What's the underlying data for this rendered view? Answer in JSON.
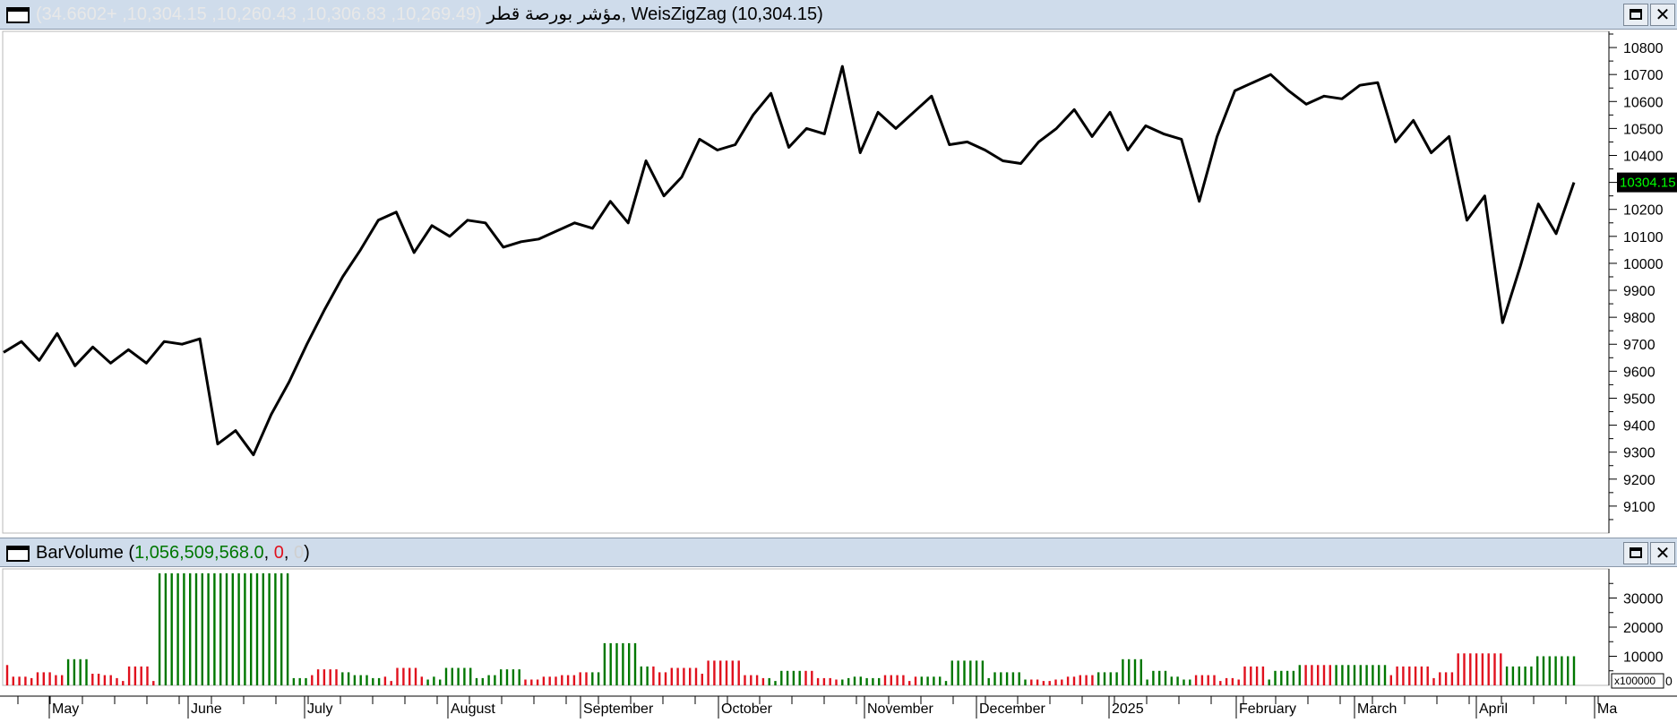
{
  "price_panel": {
    "icon": "window-icon",
    "symbol_name": "مؤشر بورصة قطر",
    "ohlc_text": "(10,269.49, 10,306.83, 10,260.43, 10,304.15, +34.6602)",
    "indicator_text": ", WeisZigZag (10,304.15)",
    "last_price_label": "10304.15",
    "last_price_color": "#000000",
    "last_price_text_color": "#00ff00"
  },
  "volume_panel": {
    "icon": "window-icon",
    "name": "BarVolume",
    "open_paren": " (",
    "value1": "1,056,509,568.0",
    "sep1": ", ",
    "value2": "0",
    "sep2": ", ",
    "value3": "0",
    "close_paren": ")",
    "scale_badge": "x100000",
    "axis_zero": "0"
  },
  "window_buttons": {
    "maximize_icon": "maximize-icon",
    "close_symbol": "✕"
  },
  "colors": {
    "up": "#007700",
    "down": "#e0101d",
    "line": "#000000",
    "title_bg": "#cfdceb"
  },
  "time_axis": {
    "labels": [
      "May",
      "June",
      "July",
      "August",
      "September",
      "October",
      "November",
      "December",
      "2025",
      "February",
      "March",
      "April",
      "Ma"
    ]
  },
  "chart_data": [
    {
      "type": "line",
      "title": "",
      "ylim": [
        9000,
        10860
      ],
      "yticks": [
        9100,
        9200,
        9300,
        9400,
        9500,
        9600,
        9700,
        9800,
        9900,
        10000,
        10100,
        10200,
        10300,
        10400,
        10500,
        10600,
        10700,
        10800
      ],
      "series": [
        {
          "values": [
            9670,
            9710,
            9640,
            9740,
            9620,
            9690,
            9630,
            9680,
            9630,
            9710,
            9700,
            9720,
            9330,
            9380,
            9290,
            9440,
            9560,
            9700,
            9830,
            9950,
            10050,
            10160,
            10190,
            10040,
            10140,
            10100,
            10160,
            10150,
            10060,
            10080,
            10090,
            10120,
            10150,
            10130,
            10230,
            10150,
            10380,
            10250,
            10320,
            10460,
            10420,
            10440,
            10550,
            10630,
            10430,
            10500,
            10480,
            10730,
            10410,
            10560,
            10500,
            10560,
            10620,
            10440,
            10450,
            10420,
            10380,
            10370,
            10450,
            10500,
            10570,
            10470,
            10560,
            10420,
            10510,
            10480,
            10460,
            10230,
            10470,
            10640,
            10670,
            10700,
            10640,
            10590,
            10620,
            10610,
            10660,
            10670,
            10450,
            10530,
            10410,
            10470,
            10160,
            10250,
            9780,
            9990,
            10220,
            10110,
            10300
          ]
        }
      ]
    },
    {
      "type": "bar",
      "title": "",
      "ylim": [
        0,
        40000
      ],
      "yticks": [
        10000,
        20000,
        30000
      ],
      "series": [
        {
          "values": [
            7000,
            3000,
            3000,
            3000,
            2500,
            4500,
            4500,
            4500,
            3500,
            3500,
            9000,
            9000,
            9000,
            9000,
            4000,
            4000,
            3500,
            3500,
            2500,
            1500,
            6500,
            6500,
            6500,
            6500,
            1500,
            38500,
            38500,
            38500,
            38500,
            38500,
            38500,
            38500,
            38500,
            38500,
            38500,
            38500,
            38500,
            38500,
            38500,
            38500,
            38500,
            38500,
            38500,
            38500,
            38500,
            38500,
            38500,
            2500,
            2500,
            2500,
            3500,
            5500,
            5500,
            5500,
            5500,
            4500,
            4500,
            3500,
            3500,
            3500,
            2500,
            2500,
            3000,
            1500,
            6000,
            6000,
            6000,
            6000,
            3000,
            2000,
            3000,
            2000,
            6000,
            6000,
            6000,
            6000,
            6000,
            2500,
            2500,
            3500,
            3500,
            5500,
            5500,
            5500,
            5500,
            2000,
            2000,
            2000,
            3000,
            3000,
            3000,
            3500,
            3500,
            3500,
            4500,
            4500,
            4500,
            4500,
            14500,
            14500,
            14500,
            14500,
            14500,
            14500,
            6500,
            6500,
            6500,
            4500,
            4500,
            6000,
            6000,
            6000,
            6000,
            6000,
            4000,
            8500,
            8500,
            8500,
            8500,
            8500,
            8500,
            3500,
            3500,
            3500,
            2500,
            2500,
            1500,
            5000,
            5000,
            5000,
            5000,
            5000,
            5000,
            2500,
            2500,
            2500,
            2000,
            2000,
            2500,
            3000,
            3000,
            2500,
            2500,
            2500,
            3500,
            3500,
            3500,
            3500,
            1500,
            3000,
            3000,
            3000,
            3000,
            3000,
            1500,
            8500,
            8500,
            8500,
            8500,
            8500,
            8500,
            2500,
            4500,
            4500,
            4500,
            4500,
            4500,
            2000,
            2000,
            2000,
            1500,
            1500,
            2000,
            2000,
            3000,
            3000,
            3500,
            3500,
            3500,
            4500,
            4500,
            4500,
            4500,
            9000,
            9000,
            9000,
            9000,
            2000,
            5000,
            5000,
            5000,
            3000,
            3000,
            2000,
            2000,
            3500,
            3500,
            3500,
            3500,
            1500,
            2500,
            2500,
            2000,
            6500,
            6500,
            6500,
            6500,
            2000,
            5000,
            5000,
            5000,
            5000,
            7000,
            7000,
            7000,
            7000,
            7000,
            7000,
            7000,
            7000,
            7000,
            7000,
            7000,
            7000,
            7000,
            7000,
            7000,
            3500,
            6500,
            6500,
            6500,
            6500,
            6500,
            6500,
            2500,
            4500,
            4500,
            4500,
            11000,
            11000,
            11000,
            11000,
            11000,
            11000,
            11000,
            11000,
            6500,
            6500,
            6500,
            6500,
            6500,
            10000,
            10000,
            10000,
            10000,
            10000,
            10000,
            10000
          ],
          "colors": [
            "down",
            "down",
            "down",
            "down",
            "down",
            "down",
            "down",
            "down",
            "down",
            "down",
            "up",
            "up",
            "up",
            "up",
            "down",
            "down",
            "down",
            "down",
            "down",
            "down",
            "down",
            "down",
            "down",
            "down",
            "down",
            "up",
            "up",
            "up",
            "up",
            "up",
            "up",
            "up",
            "up",
            "up",
            "up",
            "up",
            "up",
            "up",
            "up",
            "up",
            "up",
            "up",
            "up",
            "up",
            "up",
            "up",
            "up",
            "up",
            "up",
            "up",
            "down",
            "down",
            "down",
            "down",
            "down",
            "up",
            "up",
            "up",
            "up",
            "up",
            "up",
            "up",
            "down",
            "down",
            "down",
            "down",
            "down",
            "down",
            "down",
            "up",
            "up",
            "up",
            "up",
            "up",
            "up",
            "up",
            "up",
            "up",
            "up",
            "up",
            "up",
            "up",
            "up",
            "up",
            "up",
            "down",
            "down",
            "down",
            "down",
            "down",
            "down",
            "down",
            "down",
            "down",
            "down",
            "down",
            "up",
            "up",
            "up",
            "up",
            "up",
            "up",
            "up",
            "up",
            "up",
            "up",
            "down",
            "down",
            "down",
            "down",
            "down",
            "down",
            "down",
            "down",
            "down",
            "down",
            "down",
            "down",
            "down",
            "down",
            "down",
            "down",
            "down",
            "down",
            "down",
            "up",
            "up",
            "up",
            "up",
            "up",
            "up",
            "down",
            "down",
            "down",
            "down",
            "down",
            "down",
            "up",
            "up",
            "up",
            "up",
            "up",
            "up",
            "up",
            "down",
            "down",
            "down",
            "down",
            "down",
            "down",
            "up",
            "up",
            "up",
            "up",
            "up",
            "up",
            "up",
            "up",
            "up",
            "up",
            "up",
            "up",
            "up",
            "up",
            "up",
            "up",
            "up",
            "up",
            "down",
            "down",
            "down",
            "down",
            "down",
            "down",
            "down",
            "down",
            "down",
            "down",
            "down",
            "up",
            "up",
            "up",
            "up",
            "up",
            "up",
            "up",
            "up",
            "up",
            "up",
            "up",
            "up",
            "up",
            "up",
            "up",
            "up",
            "down",
            "down",
            "down",
            "down",
            "down",
            "down",
            "down",
            "down",
            "down",
            "down",
            "down",
            "down",
            "up",
            "up",
            "up",
            "up",
            "up",
            "up",
            "down",
            "down",
            "down",
            "down",
            "down",
            "up",
            "up",
            "up",
            "up",
            "up",
            "up",
            "up",
            "up",
            "up",
            "down",
            "down",
            "down",
            "down",
            "down",
            "down",
            "down",
            "down",
            "down",
            "down",
            "down",
            "down",
            "down",
            "down",
            "down",
            "down",
            "down",
            "down",
            "down",
            "up",
            "up",
            "up",
            "up",
            "up",
            "up",
            "up",
            "up",
            "up",
            "up",
            "up",
            "up",
            "down",
            "down",
            "down",
            "down",
            "down",
            "down",
            "up",
            "up",
            "up",
            "up",
            "up",
            "up"
          ]
        }
      ]
    }
  ]
}
